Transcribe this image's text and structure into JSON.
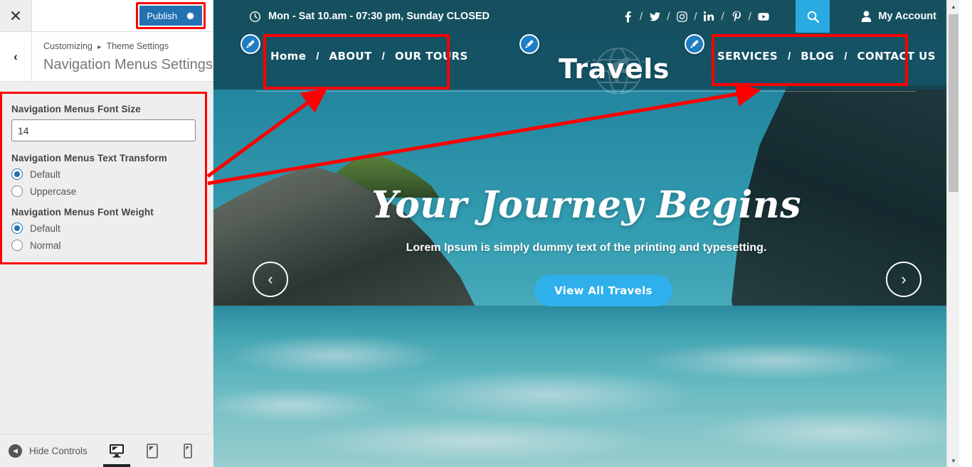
{
  "customizer": {
    "close_label": "×",
    "publish_label": "Publish",
    "gear_icon": "gear-icon",
    "back_label": "‹",
    "breadcrumb_root": "Customizing",
    "breadcrumb_separator": "▸",
    "breadcrumb_section": "Theme Settings",
    "page_title": "Navigation Menus Settings",
    "fields": [
      {
        "label": "Navigation Menus Font Size",
        "type": "text",
        "value": "14"
      },
      {
        "label": "Navigation Menus Text Transform",
        "type": "radio",
        "options": [
          {
            "label": "Default",
            "selected": true
          },
          {
            "label": "Uppercase",
            "selected": false
          }
        ]
      },
      {
        "label": "Navigation Menus Font Weight",
        "type": "radio",
        "options": [
          {
            "label": "Default",
            "selected": true
          },
          {
            "label": "Normal",
            "selected": false
          }
        ]
      }
    ],
    "footer": {
      "hide_controls_label": "Hide Controls",
      "devices": [
        {
          "name": "desktop-preview-button",
          "icon": "desktop-icon",
          "active": true
        },
        {
          "name": "tablet-preview-button",
          "icon": "tablet-icon",
          "active": false
        },
        {
          "name": "mobile-preview-button",
          "icon": "mobile-icon",
          "active": false
        }
      ]
    },
    "accent_color": "#2271b1",
    "annotation_color": "#ff0000"
  },
  "site": {
    "topbar": {
      "clock_icon": "clock-icon",
      "hours": "Mon - Sat 10.am - 07:30 pm, Sunday CLOSED",
      "socials": [
        {
          "name": "facebook-icon",
          "label": "f"
        },
        {
          "name": "twitter-icon",
          "label": "t"
        },
        {
          "name": "instagram-icon",
          "label": "ig"
        },
        {
          "name": "linkedin-icon",
          "label": "in"
        },
        {
          "name": "pinterest-icon",
          "label": "P"
        },
        {
          "name": "youtube-icon",
          "label": "yt"
        }
      ],
      "separator": "/",
      "search_icon": "search-icon",
      "account_label": "My Account",
      "account_icon": "user-icon",
      "search_bg": "#29aae2",
      "bar_bg": "#16505f"
    },
    "nav": {
      "left_items": [
        "Home",
        "ABOUT",
        "OUR TOURS"
      ],
      "right_items": [
        "SERVICES",
        "BLOG",
        "CONTACT US"
      ],
      "separator": "/",
      "logo_text": "Travels",
      "logo_watermark_icon": "airplane-globe-icon",
      "edit_pin_icon": "pencil-edit-icon"
    },
    "hero": {
      "title": "Your Journey Begins",
      "subtitle": "Lorem Ipsum is simply dummy text of the printing and typesetting.",
      "button_label": "View All Travels",
      "button_color": "#2fb0ec",
      "prev_arrow": "‹",
      "next_arrow": "›"
    }
  }
}
